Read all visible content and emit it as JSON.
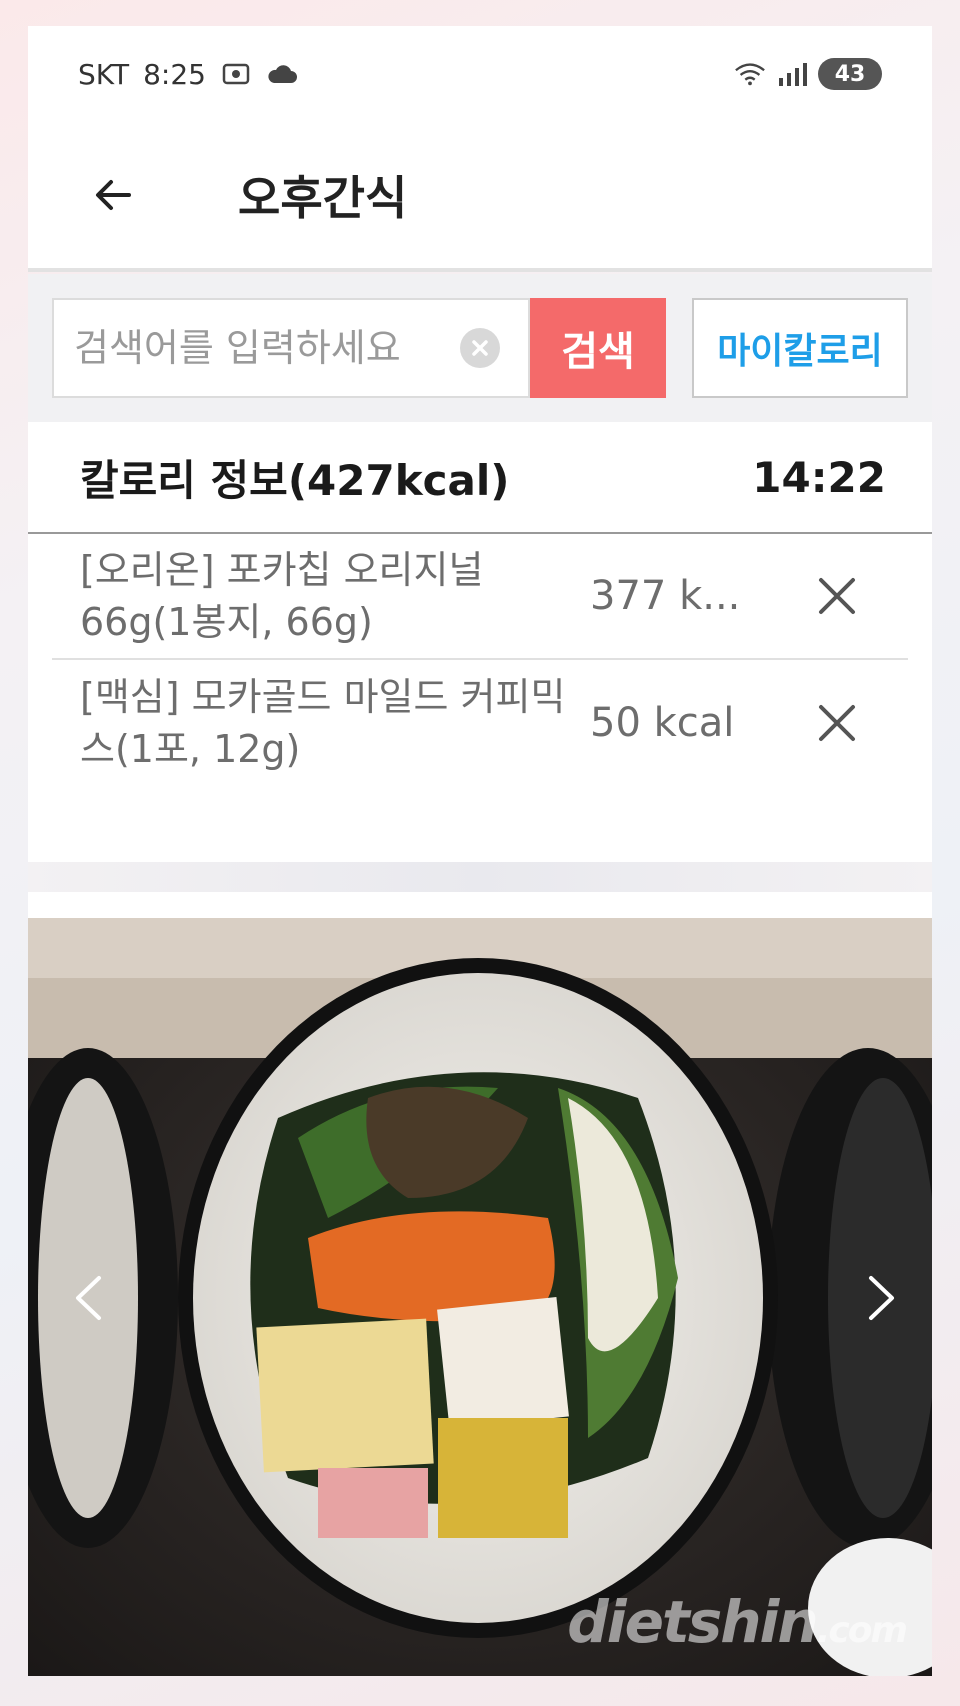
{
  "status_bar": {
    "carrier": "SKT",
    "time": "8:25",
    "battery": "43"
  },
  "header": {
    "title": "오후간식"
  },
  "search": {
    "placeholder": "검색어를 입력하세요",
    "button_label": "검색",
    "my_calorie_label": "마이칼로리"
  },
  "calorie_info": {
    "title": "칼로리 정보(427kcal)",
    "time": "14:22",
    "items": [
      {
        "name": "[오리온] 포카칩 오리지널 66g(1봉지, 66g)",
        "kcal": "377 k..."
      },
      {
        "name": "[맥심] 모카골드 마일드 커피믹스(1포, 12g)",
        "kcal": "50 kcal"
      }
    ]
  },
  "photo": {
    "watermark": "dietshin",
    "watermark_suffix": ".com"
  },
  "colors": {
    "search_button": "#f46a6a",
    "my_calorie_text": "#1e9ee8"
  }
}
